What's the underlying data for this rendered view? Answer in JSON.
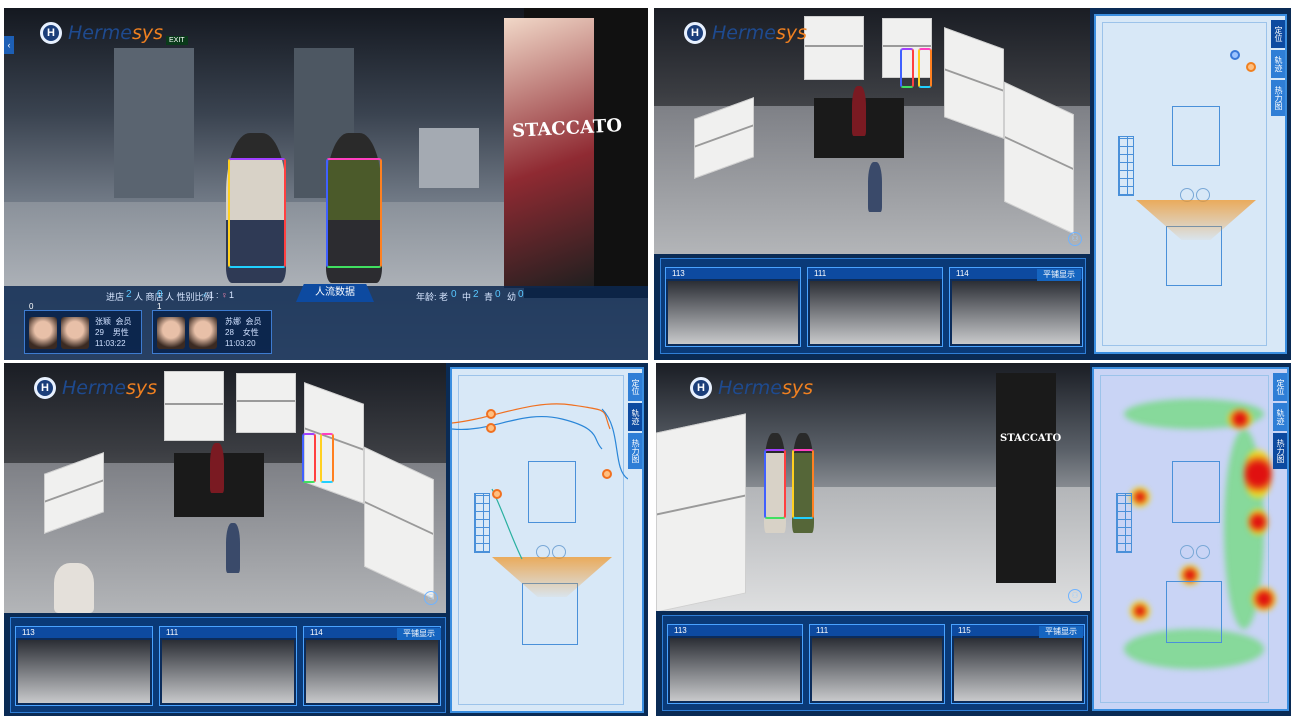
{
  "brand": {
    "name_main": "Herme",
    "name_accent": "sys",
    "mark": "H"
  },
  "q1": {
    "stats": {
      "enter_label": "进店",
      "enter_value": "2",
      "mall_label": "人 商店",
      "mall_value": "0",
      "gender_label": "人 性别比例",
      "male_value": "1",
      "female_value": "1",
      "male_icon": "male-icon",
      "female_icon": "female-icon",
      "tab_label": "人流数据",
      "age_label": "年龄: 老",
      "age_old": "0",
      "age_mid_label": "中",
      "age_mid": "2",
      "age_young_label": "青",
      "age_young": "0",
      "age_child_label": "幼",
      "age_child": "0"
    },
    "cards": [
      {
        "index": "0",
        "name": "张颖",
        "type": "会员",
        "age": "29",
        "gender": "男性",
        "time": "11:03:22"
      },
      {
        "index": "1",
        "name": "苏娜",
        "type": "会员",
        "age": "28",
        "gender": "女性",
        "time": "11:03:20"
      }
    ],
    "exit_sign": "EXIT",
    "poster_text": "STACCATO",
    "back_glyph": "‹"
  },
  "q2": {
    "tabs": [
      "定位",
      "轨迹",
      "热力图"
    ],
    "active_tab": 0,
    "thumbs": [
      "113",
      "111",
      "114"
    ],
    "tile_button": "平铺显示"
  },
  "q3": {
    "tabs": [
      "定位",
      "轨迹",
      "热力图"
    ],
    "active_tab": 1,
    "thumbs": [
      "113",
      "111",
      "114"
    ],
    "tile_button": "平铺显示"
  },
  "q4": {
    "tabs": [
      "定位",
      "轨迹",
      "热力图"
    ],
    "active_tab": 2,
    "thumbs": [
      "113",
      "111",
      "115"
    ],
    "tile_button": "平铺显示",
    "store_sign": "STACCATO"
  },
  "colors": {
    "accent": "#0d4aa0",
    "panel": "#d8e8f7",
    "cone": "#f09628",
    "heat_hot": "#e01010",
    "heat_warm": "#f0e020",
    "heat_cool": "#30d040"
  }
}
